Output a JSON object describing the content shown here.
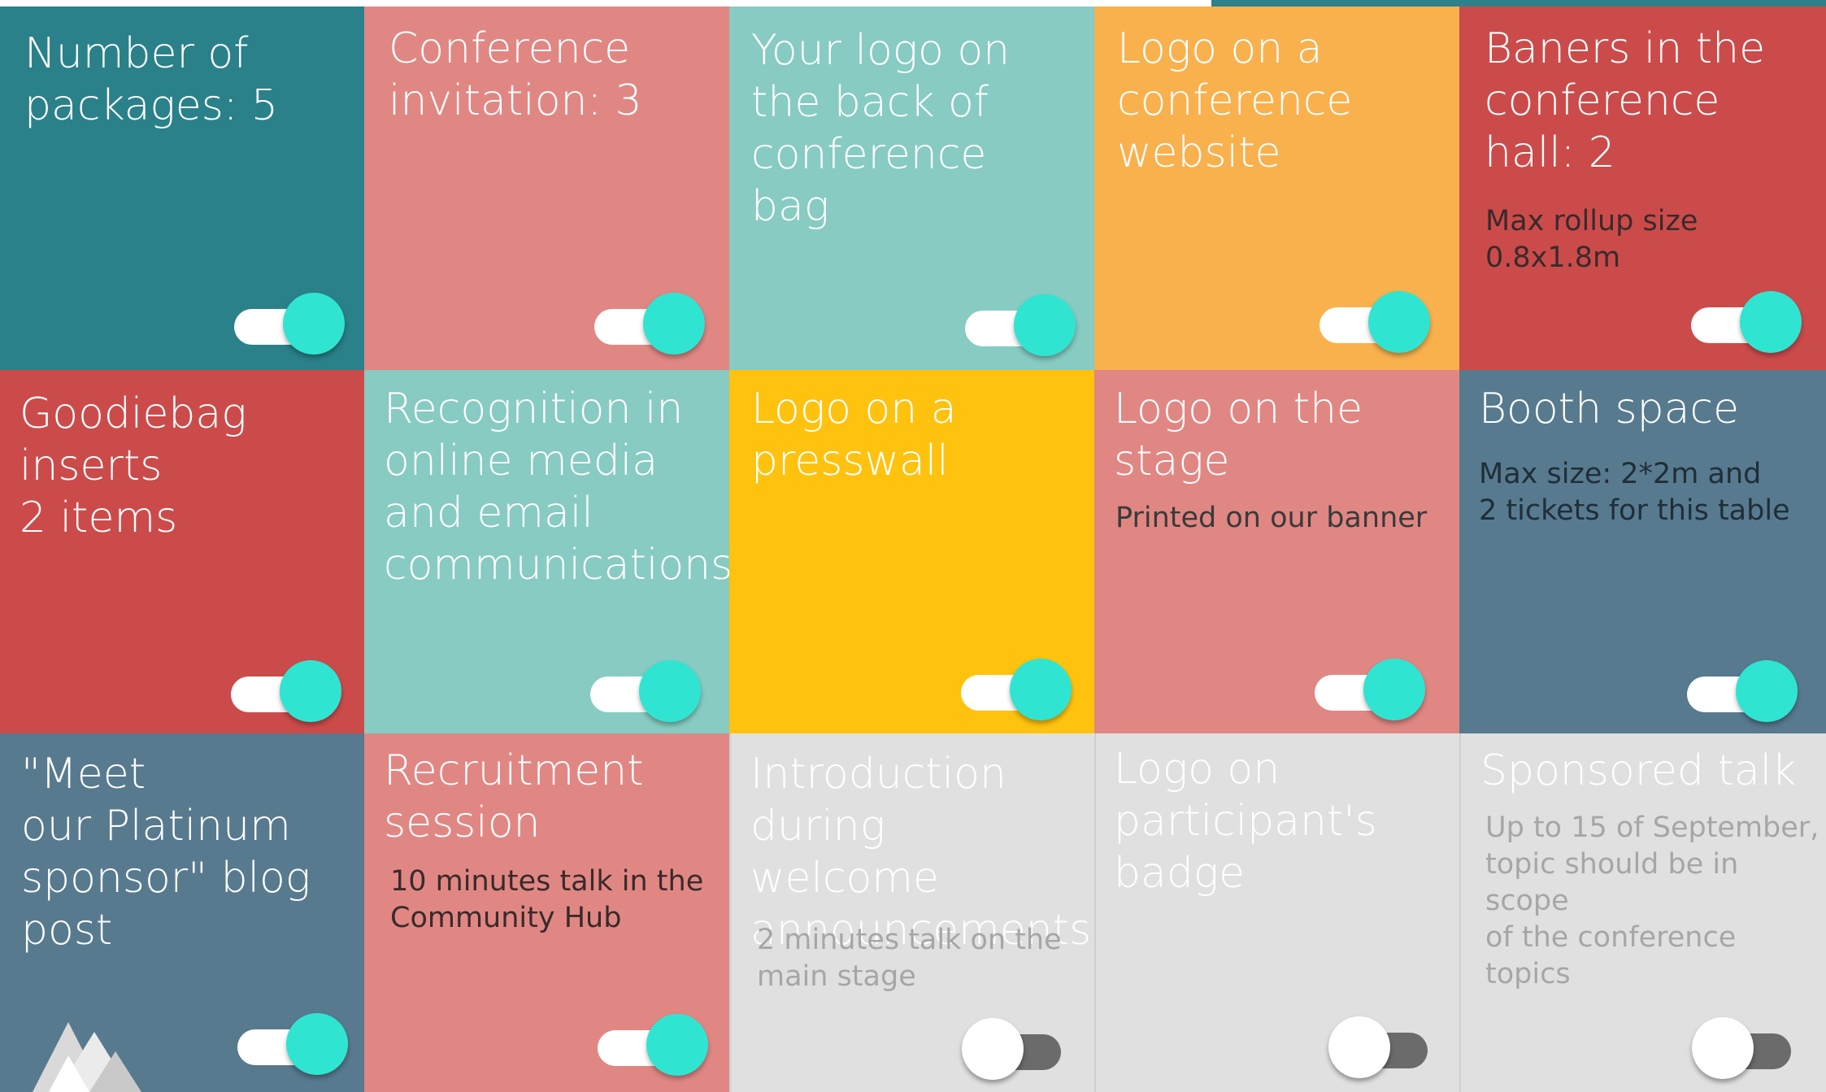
{
  "colors": {
    "teal_dark": "#2a8189",
    "salmon": "#e08784",
    "mint": "#87cbc2",
    "orange": "#f9b14e",
    "red": "#cb4b4b",
    "yellow": "#fec20f",
    "slate": "#577a8e",
    "disabled": "#e0e0e0",
    "toggle_on": "#2fe5d2",
    "toggle_off": "#6b6b6b"
  },
  "tiles": [
    {
      "title": "Number of\npackages: 5",
      "desc": "",
      "enabled": true
    },
    {
      "title": "Conference\ninvitation: 3",
      "desc": "",
      "enabled": true
    },
    {
      "title": "Your logo on\nthe back of\nconference\nbag",
      "desc": "",
      "enabled": true
    },
    {
      "title": "Logo on a\nconference\nwebsite",
      "desc": "",
      "enabled": true
    },
    {
      "title": "Baners in the\nconference\nhall: 2",
      "desc": "Max rollup size\n0.8x1.8m",
      "enabled": true
    },
    {
      "title": "Goodiebag\ninserts\n2 items",
      "desc": "",
      "enabled": true
    },
    {
      "title": "Recognition in\nonline media\nand email\ncommunications",
      "desc": "",
      "enabled": true
    },
    {
      "title": "Logo on a\npresswall",
      "desc": "",
      "enabled": true
    },
    {
      "title": "Logo on the\nstage",
      "desc": "Printed on our banner",
      "enabled": true
    },
    {
      "title": "Booth space",
      "desc": "Max size: 2*2m and\n2 tickets for this table",
      "enabled": true
    },
    {
      "title": "\"Meet\nour Platinum\nsponsor\" blog\npost",
      "desc": "",
      "enabled": true
    },
    {
      "title": "Recruitment\nsession",
      "desc": "10 minutes talk in the\nCommunity Hub",
      "enabled": true
    },
    {
      "title": "Introduction\nduring welcome\nannouncements",
      "desc": "2 minutes talk on the\nmain stage",
      "enabled": false
    },
    {
      "title": "Logo on\nparticipant's\nbadge",
      "desc": "",
      "enabled": false
    },
    {
      "title": "Sponsored talk",
      "desc": "Up to 15 of September,\ntopic should be in scope\nof the conference topics",
      "enabled": false
    }
  ]
}
